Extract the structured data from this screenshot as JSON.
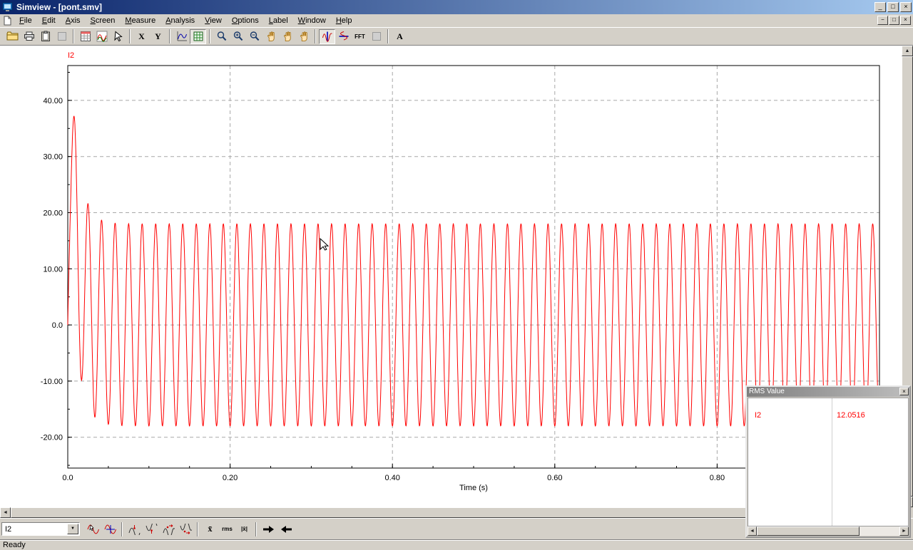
{
  "window": {
    "title": "Simview - [pont.smv]",
    "controls": {
      "minimize": "_",
      "maximize": "□",
      "close": "×"
    }
  },
  "menu_bar": {
    "items": [
      "File",
      "Edit",
      "Axis",
      "Screen",
      "Measure",
      "Analysis",
      "View",
      "Options",
      "Label",
      "Window",
      "Help"
    ],
    "mdi_controls": {
      "minimize": "−",
      "restore": "□",
      "close": "×"
    }
  },
  "toolbar": {
    "buttons": [
      {
        "name": "open",
        "icon": "folder-open-icon"
      },
      {
        "name": "print",
        "icon": "printer-icon"
      },
      {
        "name": "copy",
        "icon": "clipboard-icon"
      },
      {
        "name": "unavailable-1",
        "icon": "blank-icon",
        "disabled": true
      },
      {
        "sep": true
      },
      {
        "name": "view-data-points",
        "icon": "data-sheet-icon"
      },
      {
        "name": "plot-properties",
        "icon": "curves-icon"
      },
      {
        "name": "select",
        "icon": "pointer-icon"
      },
      {
        "sep": true
      },
      {
        "name": "x-axis-settings",
        "label": "X"
      },
      {
        "name": "y-axis-settings",
        "label": "Y"
      },
      {
        "sep": true
      },
      {
        "name": "add-screen",
        "icon": "line-graph-icon"
      },
      {
        "name": "grid",
        "icon": "grid-icon",
        "active": true
      },
      {
        "sep": true
      },
      {
        "name": "zoom",
        "icon": "magnifier-icon"
      },
      {
        "name": "zoom-in",
        "icon": "magnifier-plus-icon"
      },
      {
        "name": "zoom-out",
        "icon": "magnifier-minus-icon"
      },
      {
        "name": "pan",
        "icon": "hand-icon"
      },
      {
        "name": "pan-horizontal",
        "icon": "hand-icon"
      },
      {
        "name": "pan-vertical",
        "icon": "hand-icon"
      },
      {
        "sep": true
      },
      {
        "name": "measure-x",
        "icon": "measure-x-icon",
        "active": true
      },
      {
        "name": "measure-y",
        "icon": "measure-y-icon"
      },
      {
        "name": "fft",
        "label": "FFT",
        "small": true
      },
      {
        "name": "unavailable-2",
        "icon": "blank-icon",
        "disabled": true
      },
      {
        "sep": true
      },
      {
        "name": "add-text",
        "label": "A"
      }
    ]
  },
  "chart_data": {
    "type": "line",
    "series_label": "I2",
    "series_color": "#ff0000",
    "xlabel": "Time (s)",
    "x_ticks": [
      "0.0",
      "0.20",
      "0.40",
      "0.60",
      "0.80"
    ],
    "x_tick_values": [
      0,
      0.2,
      0.4,
      0.6,
      0.8
    ],
    "x_range": [
      0,
      1.0
    ],
    "y_ticks": [
      "40.00",
      "30.00",
      "20.00",
      "10.00",
      "0.0",
      "-10.00",
      "-20.00"
    ],
    "y_tick_values": [
      40,
      30,
      20,
      10,
      0,
      -10,
      -20
    ],
    "y_range": [
      -25.5,
      46.2
    ],
    "grid": "dashed",
    "waveform": {
      "shape": "sinusoid-with-decaying-dc-transient",
      "frequency_hz": 60,
      "steady_peak": 18,
      "first_peak": 37,
      "dc_tau_s": 0.01,
      "start_tau_s": 0.002,
      "duration_s": 1.0,
      "rms": 12.0516
    }
  },
  "rms_window": {
    "title": "RMS Value",
    "close": "×",
    "rows": [
      {
        "signal": "I2",
        "value": "12.0516"
      }
    ]
  },
  "measure_bar": {
    "signal_selector": {
      "value": "I2"
    },
    "dropdown_arrow": "▼",
    "buttons": [
      {
        "name": "measure-snap",
        "icon": "sine-pointer-icon"
      },
      {
        "name": "measure-crosshair",
        "icon": "sine-cross-icon"
      },
      {
        "sep": true
      },
      {
        "name": "global-max",
        "icon": "wave-max-icon"
      },
      {
        "name": "global-min",
        "icon": "wave-min-icon"
      },
      {
        "name": "next-peak",
        "icon": "wave-next-peak-icon"
      },
      {
        "name": "next-valley",
        "icon": "wave-next-valley-icon"
      },
      {
        "sep": true
      },
      {
        "name": "average",
        "label": "x̄"
      },
      {
        "name": "rms",
        "label": "rms"
      },
      {
        "name": "average-abs",
        "label": "|x̄|"
      },
      {
        "sep": true
      },
      {
        "name": "next-point-right",
        "icon": "arrow-right-icon"
      },
      {
        "name": "next-point-left",
        "icon": "arrow-left-icon"
      }
    ]
  },
  "scrollbars": {
    "up": "▲",
    "down": "▼",
    "left": "◄",
    "right": "►"
  },
  "status_bar": {
    "text": "Ready"
  }
}
